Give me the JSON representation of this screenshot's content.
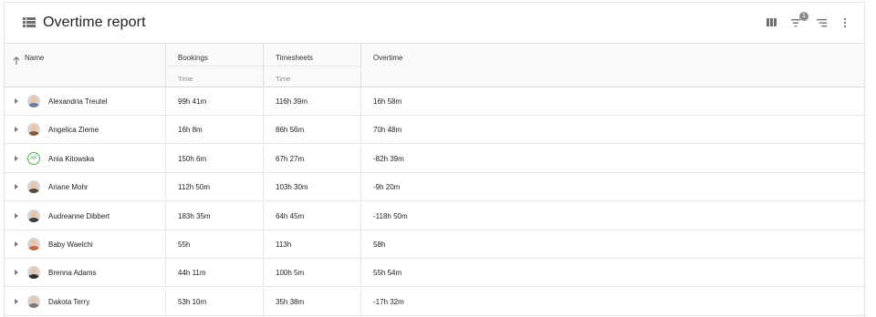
{
  "header": {
    "title": "Overtime report",
    "filter_badge": "1",
    "icons": [
      "list-icon",
      "columns-icon",
      "filter-icon",
      "sort-lines-icon",
      "more-vert-icon"
    ]
  },
  "columns": {
    "name": "Name",
    "bookings": "Bookings",
    "bookings_sub": "Time",
    "timesheets": "Timesheets",
    "timesheets_sub": "Time",
    "overtime": "Overtime"
  },
  "rows": [
    {
      "name": "Alexandria Treutel",
      "bookings": "99h 41m",
      "timesheets": "116h 39m",
      "overtime": "16h 58m",
      "avatar": "photo"
    },
    {
      "name": "Angelica Zieme",
      "bookings": "16h 8m",
      "timesheets": "86h 56m",
      "overtime": "70h 48m",
      "avatar": "photo"
    },
    {
      "name": "Ania Kitowska",
      "bookings": "150h 6m",
      "timesheets": "67h 27m",
      "overtime": "-82h 39m",
      "avatar": "initials",
      "initials": "AK"
    },
    {
      "name": "Ariane Mohr",
      "bookings": "112h 50m",
      "timesheets": "103h 30m",
      "overtime": "-9h 20m",
      "avatar": "photo"
    },
    {
      "name": "Audreanne Dibbert",
      "bookings": "183h 35m",
      "timesheets": "64h 45m",
      "overtime": "-118h 50m",
      "avatar": "photo"
    },
    {
      "name": "Baby Waelchi",
      "bookings": "55h",
      "timesheets": "113h",
      "overtime": "58h",
      "avatar": "photo"
    },
    {
      "name": "Brenna Adams",
      "bookings": "44h 11m",
      "timesheets": "100h 5m",
      "overtime": "55h 54m",
      "avatar": "photo"
    },
    {
      "name": "Dakota Terry",
      "bookings": "53h 10m",
      "timesheets": "35h 38m",
      "overtime": "-17h 32m",
      "avatar": "photo"
    }
  ],
  "colors": {
    "initials_accent": "#4caf50",
    "icon_gray": "#6f6f6f",
    "border": "#e3e3e3"
  }
}
